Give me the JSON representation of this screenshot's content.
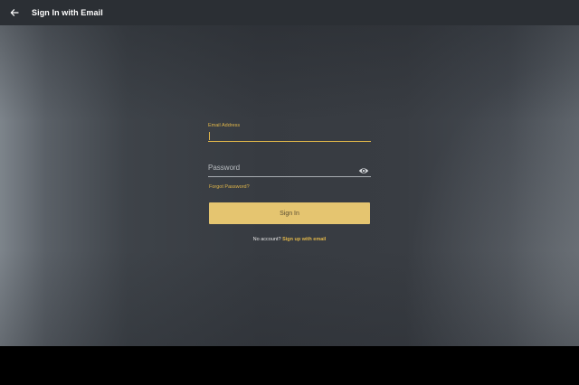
{
  "app_bar": {
    "title": "Sign In with Email",
    "back_icon": "arrow-left-icon"
  },
  "form": {
    "email": {
      "label": "Email Address",
      "value": ""
    },
    "password": {
      "placeholder": "Password",
      "value": "",
      "visibility_icon": "eye-icon"
    },
    "forgot_password": "Forgot Password?",
    "sign_in_button": "Sign In",
    "no_account_text": "No account?",
    "sign_up_link": "Sign up with email"
  },
  "colors": {
    "accent": "#e0b64a",
    "button": "#e5c570",
    "app_bar": "#2b2f34",
    "background": "#3a3e44"
  }
}
